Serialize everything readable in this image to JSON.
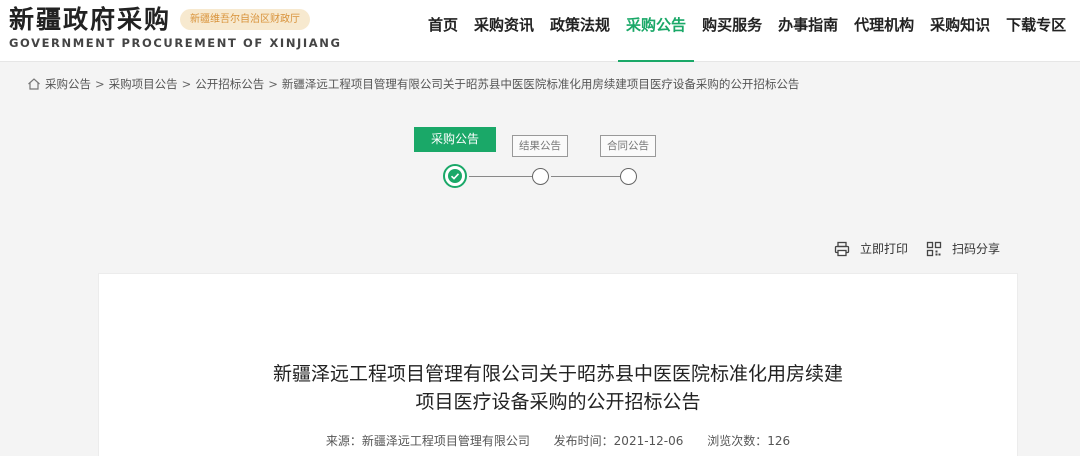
{
  "brand": {
    "title_cn": "新疆政府采购",
    "badge": "新疆维吾尔自治区财政厅",
    "title_en": "GOVERNMENT PROCUREMENT OF XINJIANG"
  },
  "nav": [
    "首页",
    "采购资讯",
    "政策法规",
    "采购公告",
    "购买服务",
    "办事指南",
    "代理机构",
    "采购知识",
    "下载专区"
  ],
  "nav_active_index": 3,
  "breadcrumb": {
    "items": [
      "采购公告",
      "采购项目公告",
      "公开招标公告",
      "新疆泽远工程项目管理有限公司关于昭苏县中医医院标准化用房续建项目医疗设备采购的公开招标公告"
    ],
    "separator": ">"
  },
  "steps": {
    "current": "采购公告",
    "result": "结果公告",
    "contract": "合同公告"
  },
  "tools": {
    "print": "立即打印",
    "share": "扫码分享"
  },
  "article": {
    "title_line1": "新疆泽远工程项目管理有限公司关于昭苏县中医医院标准化用房续建",
    "title_line2": "项目医疗设备采购的公开招标公告",
    "source": "来源：新疆泽远工程项目管理有限公司",
    "publish_time": "发布时间：2021-12-06",
    "views": "浏览次数：126"
  },
  "colors": {
    "accent": "#1aa868",
    "badge_bg": "#f7e9cf",
    "badge_text": "#d8923a"
  }
}
